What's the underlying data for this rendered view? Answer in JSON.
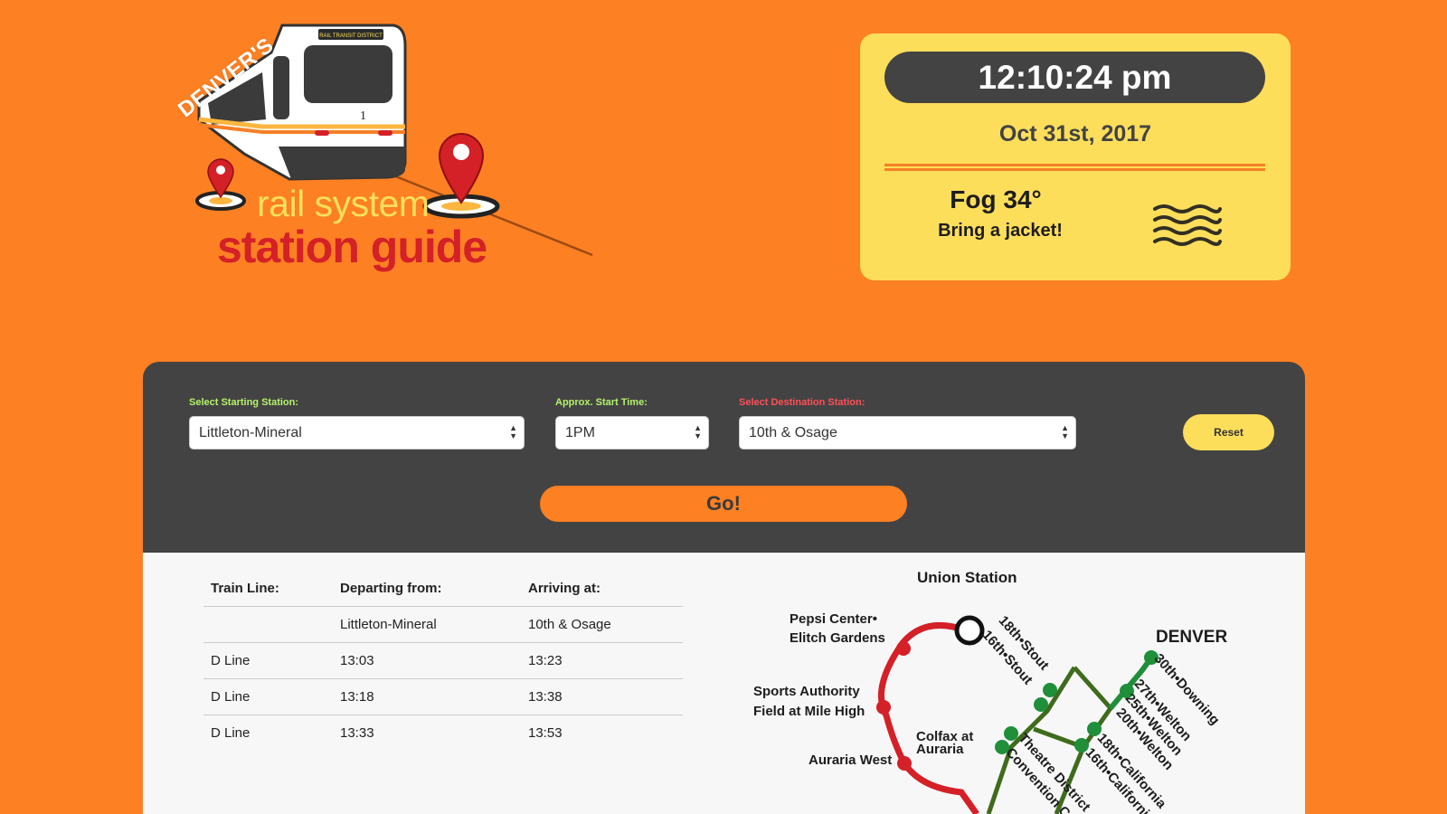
{
  "logo": {
    "denvers": "DENVER'S",
    "bus_sign": "RAIL TRANSIT DISTRICT",
    "bus_number": "1",
    "line1": "rail system",
    "line2": "station guide"
  },
  "info": {
    "time": "12:10:24 pm",
    "date": "Oct 31st, 2017",
    "condition": "Fog 34°",
    "tip": "Bring a jacket!",
    "icon": "fog-icon"
  },
  "planner": {
    "start_label": "Select Starting Station:",
    "start_value": "Littleton-Mineral",
    "time_label": "Approx. Start Time:",
    "time_value": "1PM",
    "dest_label": "Select Destination Station:",
    "dest_value": "10th & Osage",
    "reset_label": "Reset",
    "go_label": "Go!"
  },
  "schedule": {
    "headers": [
      "Train Line:",
      "Departing from:",
      "Arriving at:"
    ],
    "rows": [
      [
        "",
        "Littleton-Mineral",
        "10th & Osage"
      ],
      [
        "D Line",
        "13:03",
        "13:23"
      ],
      [
        "D Line",
        "13:18",
        "13:38"
      ],
      [
        "D Line",
        "13:33",
        "13:53"
      ]
    ]
  },
  "map": {
    "union_station": "Union Station",
    "denver": "DENVER",
    "pepsi_1": "Pepsi Center•",
    "pepsi_2": "Elitch Gardens",
    "sports_1": "Sports Authority",
    "sports_2": "Field at Mile High",
    "auraria_west": "Auraria West",
    "colfax_1": "Colfax at",
    "colfax_2": "Auraria",
    "stout18": "18th•Stout",
    "stout16": "16th•Stout",
    "downing": "30th•Downing",
    "welton27": "27th•Welton",
    "welton25": "25th•Welton",
    "welton20": "20th•Welton",
    "calif18": "18th•California",
    "calif16": "16th•California",
    "theatre": "Theatre District",
    "convention": "Convention Center",
    "colors": {
      "red_line": "#D42027",
      "green_line": "#1F8F3A",
      "trunk": "#3F6B1D"
    }
  }
}
